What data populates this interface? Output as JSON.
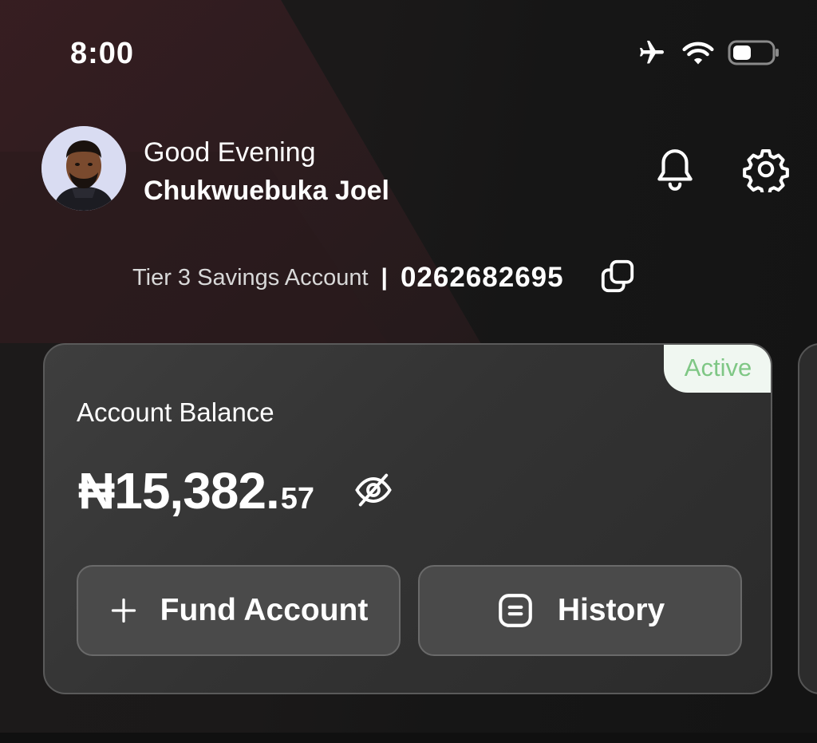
{
  "status_bar": {
    "time": "8:00"
  },
  "header": {
    "greeting": "Good Evening",
    "user_name": "Chukwuebuka Joel"
  },
  "account": {
    "tier": "Tier 3 Savings Account",
    "separator": "|",
    "number": "0262682695"
  },
  "card": {
    "badge": "Active",
    "label": "Account Balance",
    "balance_main": "₦15,382.",
    "balance_decimal": "57",
    "buttons": {
      "fund": "Fund Account",
      "history": "History"
    }
  },
  "icons": [
    "airplane-icon",
    "wifi-icon",
    "battery-icon",
    "bell-icon",
    "gear-icon",
    "copy-icon",
    "eye-off-icon",
    "plus-icon",
    "history-icon"
  ],
  "colors": {
    "active_badge_bg": "#f0f7f1",
    "active_badge_text": "#7fc785",
    "accent_bg": "#3a1e22"
  }
}
